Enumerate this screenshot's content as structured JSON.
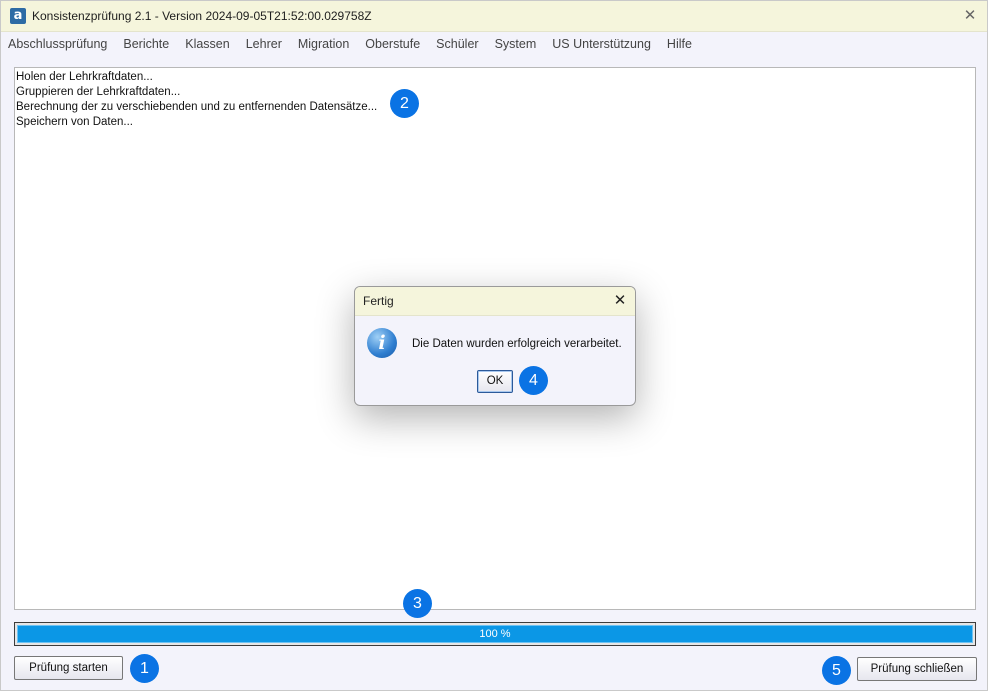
{
  "window": {
    "title": "Konsistenzprüfung 2.1 - Version 2024-09-05T21:52:00.029758Z",
    "app_icon_glyph": "a",
    "close_glyph": "✕"
  },
  "menu": [
    {
      "label": "Abschlussprüfung"
    },
    {
      "label": "Berichte"
    },
    {
      "label": "Klassen"
    },
    {
      "label": "Lehrer"
    },
    {
      "label": "Migration"
    },
    {
      "label": "Oberstufe"
    },
    {
      "label": "Schüler"
    },
    {
      "label": "System"
    },
    {
      "label": "US Unterstützung"
    },
    {
      "label": "Hilfe"
    }
  ],
  "log": {
    "lines": [
      "Holen der Lehrkraftdaten...",
      "Gruppieren der Lehrkraftdaten...",
      "Berechnung der zu verschiebenden und zu entfernenden Datensätze...",
      "Speichern von Daten..."
    ]
  },
  "progress": {
    "value_percent": 100,
    "label": "100 %"
  },
  "buttons": {
    "start": "Prüfung starten",
    "close": "Prüfung schließen"
  },
  "dialog": {
    "title": "Fertig",
    "close_glyph": "✕",
    "icon": "info-icon",
    "icon_glyph": "i",
    "message": "Die Daten wurden erfolgreich verarbeitet.",
    "ok_label": "OK"
  },
  "badges": [
    "1",
    "2",
    "3",
    "4",
    "5"
  ],
  "colors": {
    "titlebar": "#f5f5dc",
    "progress_fill": "#0b97e6",
    "badge": "#0a73e4"
  }
}
